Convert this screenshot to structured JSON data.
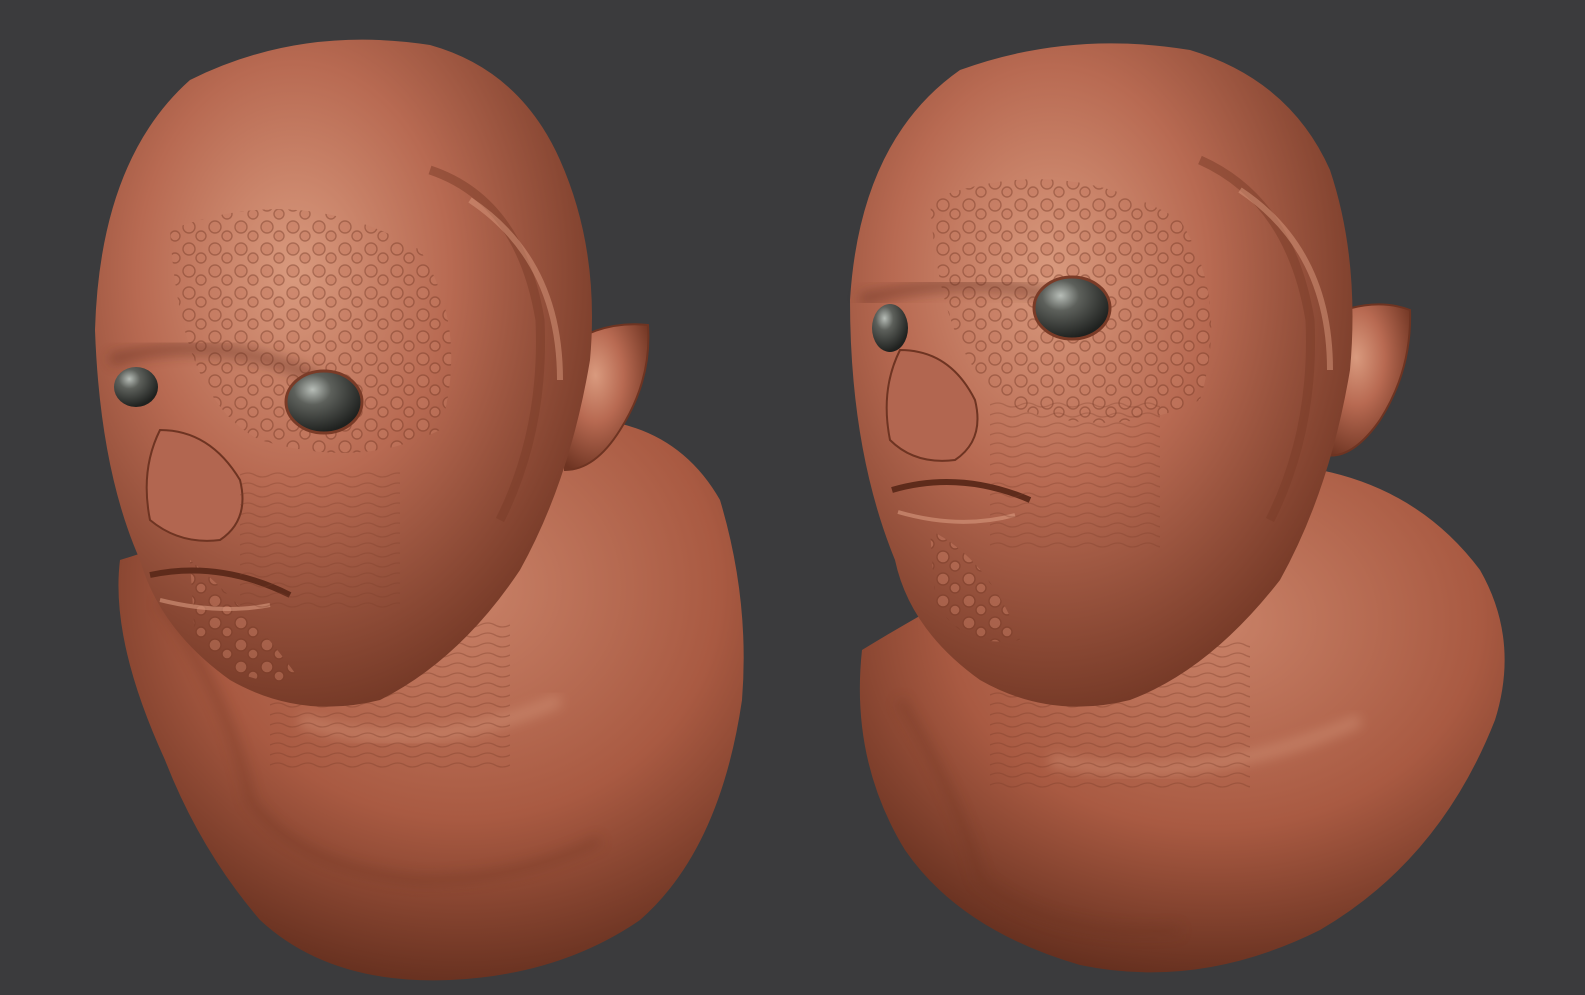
{
  "scene": {
    "background_color": "#3b3b3d",
    "subject": "sculpt-bust",
    "material_color": "#b86a52",
    "material_shadow": "#6e3422",
    "material_highlight": "#d99a7e",
    "eye_color": "#4a4c48",
    "views": [
      {
        "id": "left-view",
        "orientation": "three-quarter-left"
      },
      {
        "id": "right-view",
        "orientation": "three-quarter-left-raised"
      }
    ]
  }
}
